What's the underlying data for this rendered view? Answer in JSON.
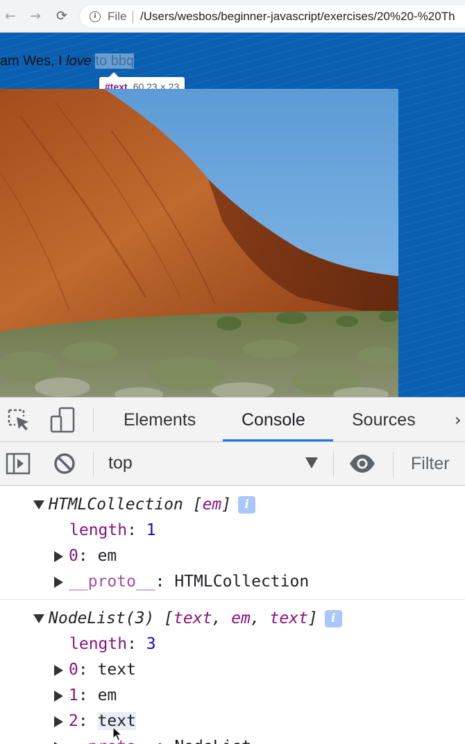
{
  "browser": {
    "scheme": "File",
    "url": "/Users/wesbos/beginner-javascript/exercises/20%20-%20Th",
    "nav_back": "←",
    "nav_forward": "→",
    "nav_reload": "⟳",
    "info_glyph": "i"
  },
  "page": {
    "sentence_start": "am Wes, I ",
    "sentence_em": "love",
    "sentence_space": " ",
    "sentence_highlight": "to bbq",
    "background_color": "#0a5fb1",
    "tooltip": {
      "tag": "#text",
      "size": "60.23 × 23"
    }
  },
  "devtools": {
    "tabs": [
      {
        "label": "Elements",
        "active": false
      },
      {
        "label": "Console",
        "active": true
      },
      {
        "label": "Sources",
        "active": false
      }
    ],
    "more_tabs": "›",
    "context": "top",
    "filter_placeholder": "Filter",
    "accent_color": "#1a73e8"
  },
  "console": {
    "group1": {
      "type": "HTMLCollection",
      "preview_open": " [",
      "preview_items": [
        "em"
      ],
      "preview_close": "]",
      "rows": [
        {
          "key": "length",
          "sep": ": ",
          "value": "1"
        },
        {
          "key": "0",
          "sep": ": ",
          "value": "em"
        },
        {
          "key": "__proto__",
          "sep": ": ",
          "value": "HTMLCollection"
        }
      ]
    },
    "group2": {
      "type": "NodeList(3)",
      "preview_open": " [",
      "preview_items": [
        "text",
        "em",
        "text"
      ],
      "preview_sep": ", ",
      "preview_close": "]",
      "rows": [
        {
          "key": "length",
          "sep": ": ",
          "value": "3"
        },
        {
          "key": "0",
          "sep": ": ",
          "value": "text"
        },
        {
          "key": "1",
          "sep": ": ",
          "value": "em"
        },
        {
          "key": "2",
          "sep": ": ",
          "value": "text"
        },
        {
          "key": "__proto__",
          "sep": ": ",
          "value": "NodeList"
        }
      ]
    },
    "info_badge": "i"
  }
}
